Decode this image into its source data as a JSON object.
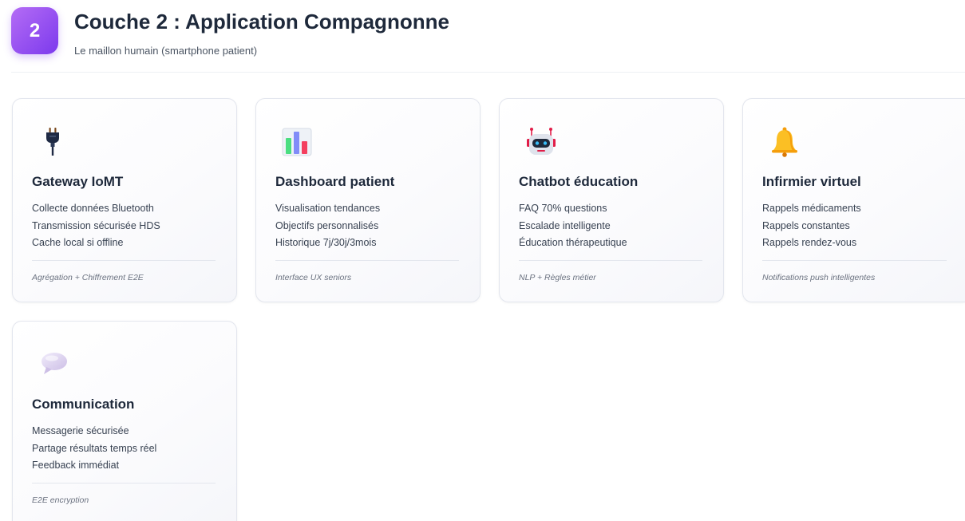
{
  "header": {
    "layer_number": "2",
    "title": "Couche 2 : Application Compagnonne",
    "subtitle": "Le maillon humain (smartphone patient)"
  },
  "cards": [
    {
      "icon": "plug-icon",
      "title": "Gateway IoMT",
      "items": [
        "Collecte données Bluetooth",
        "Transmission sécurisée HDS",
        "Cache local si offline"
      ],
      "footer": "Agrégation + Chiffrement E2E"
    },
    {
      "icon": "bar-chart-icon",
      "title": "Dashboard patient",
      "items": [
        "Visualisation tendances",
        "Objectifs personnalisés",
        "Historique 7j/30j/3mois"
      ],
      "footer": "Interface UX seniors"
    },
    {
      "icon": "robot-icon",
      "title": "Chatbot éducation",
      "items": [
        "FAQ 70% questions",
        "Escalade intelligente",
        "Éducation thérapeutique"
      ],
      "footer": "NLP + Règles métier"
    },
    {
      "icon": "bell-icon",
      "title": "Infirmier virtuel",
      "items": [
        "Rappels médicaments",
        "Rappels constantes",
        "Rappels rendez-vous"
      ],
      "footer": "Notifications push intelligentes"
    },
    {
      "icon": "speech-bubble-icon",
      "title": "Communication",
      "items": [
        "Messagerie sécurisée",
        "Partage résultats temps réel",
        "Feedback immédiat"
      ],
      "footer": "E2E encryption"
    }
  ],
  "colors": {
    "badge_gradient_start": "#b46cf5",
    "badge_gradient_end": "#7c3aed",
    "card_border": "#e3e6ee",
    "title_text": "#1e293b"
  }
}
